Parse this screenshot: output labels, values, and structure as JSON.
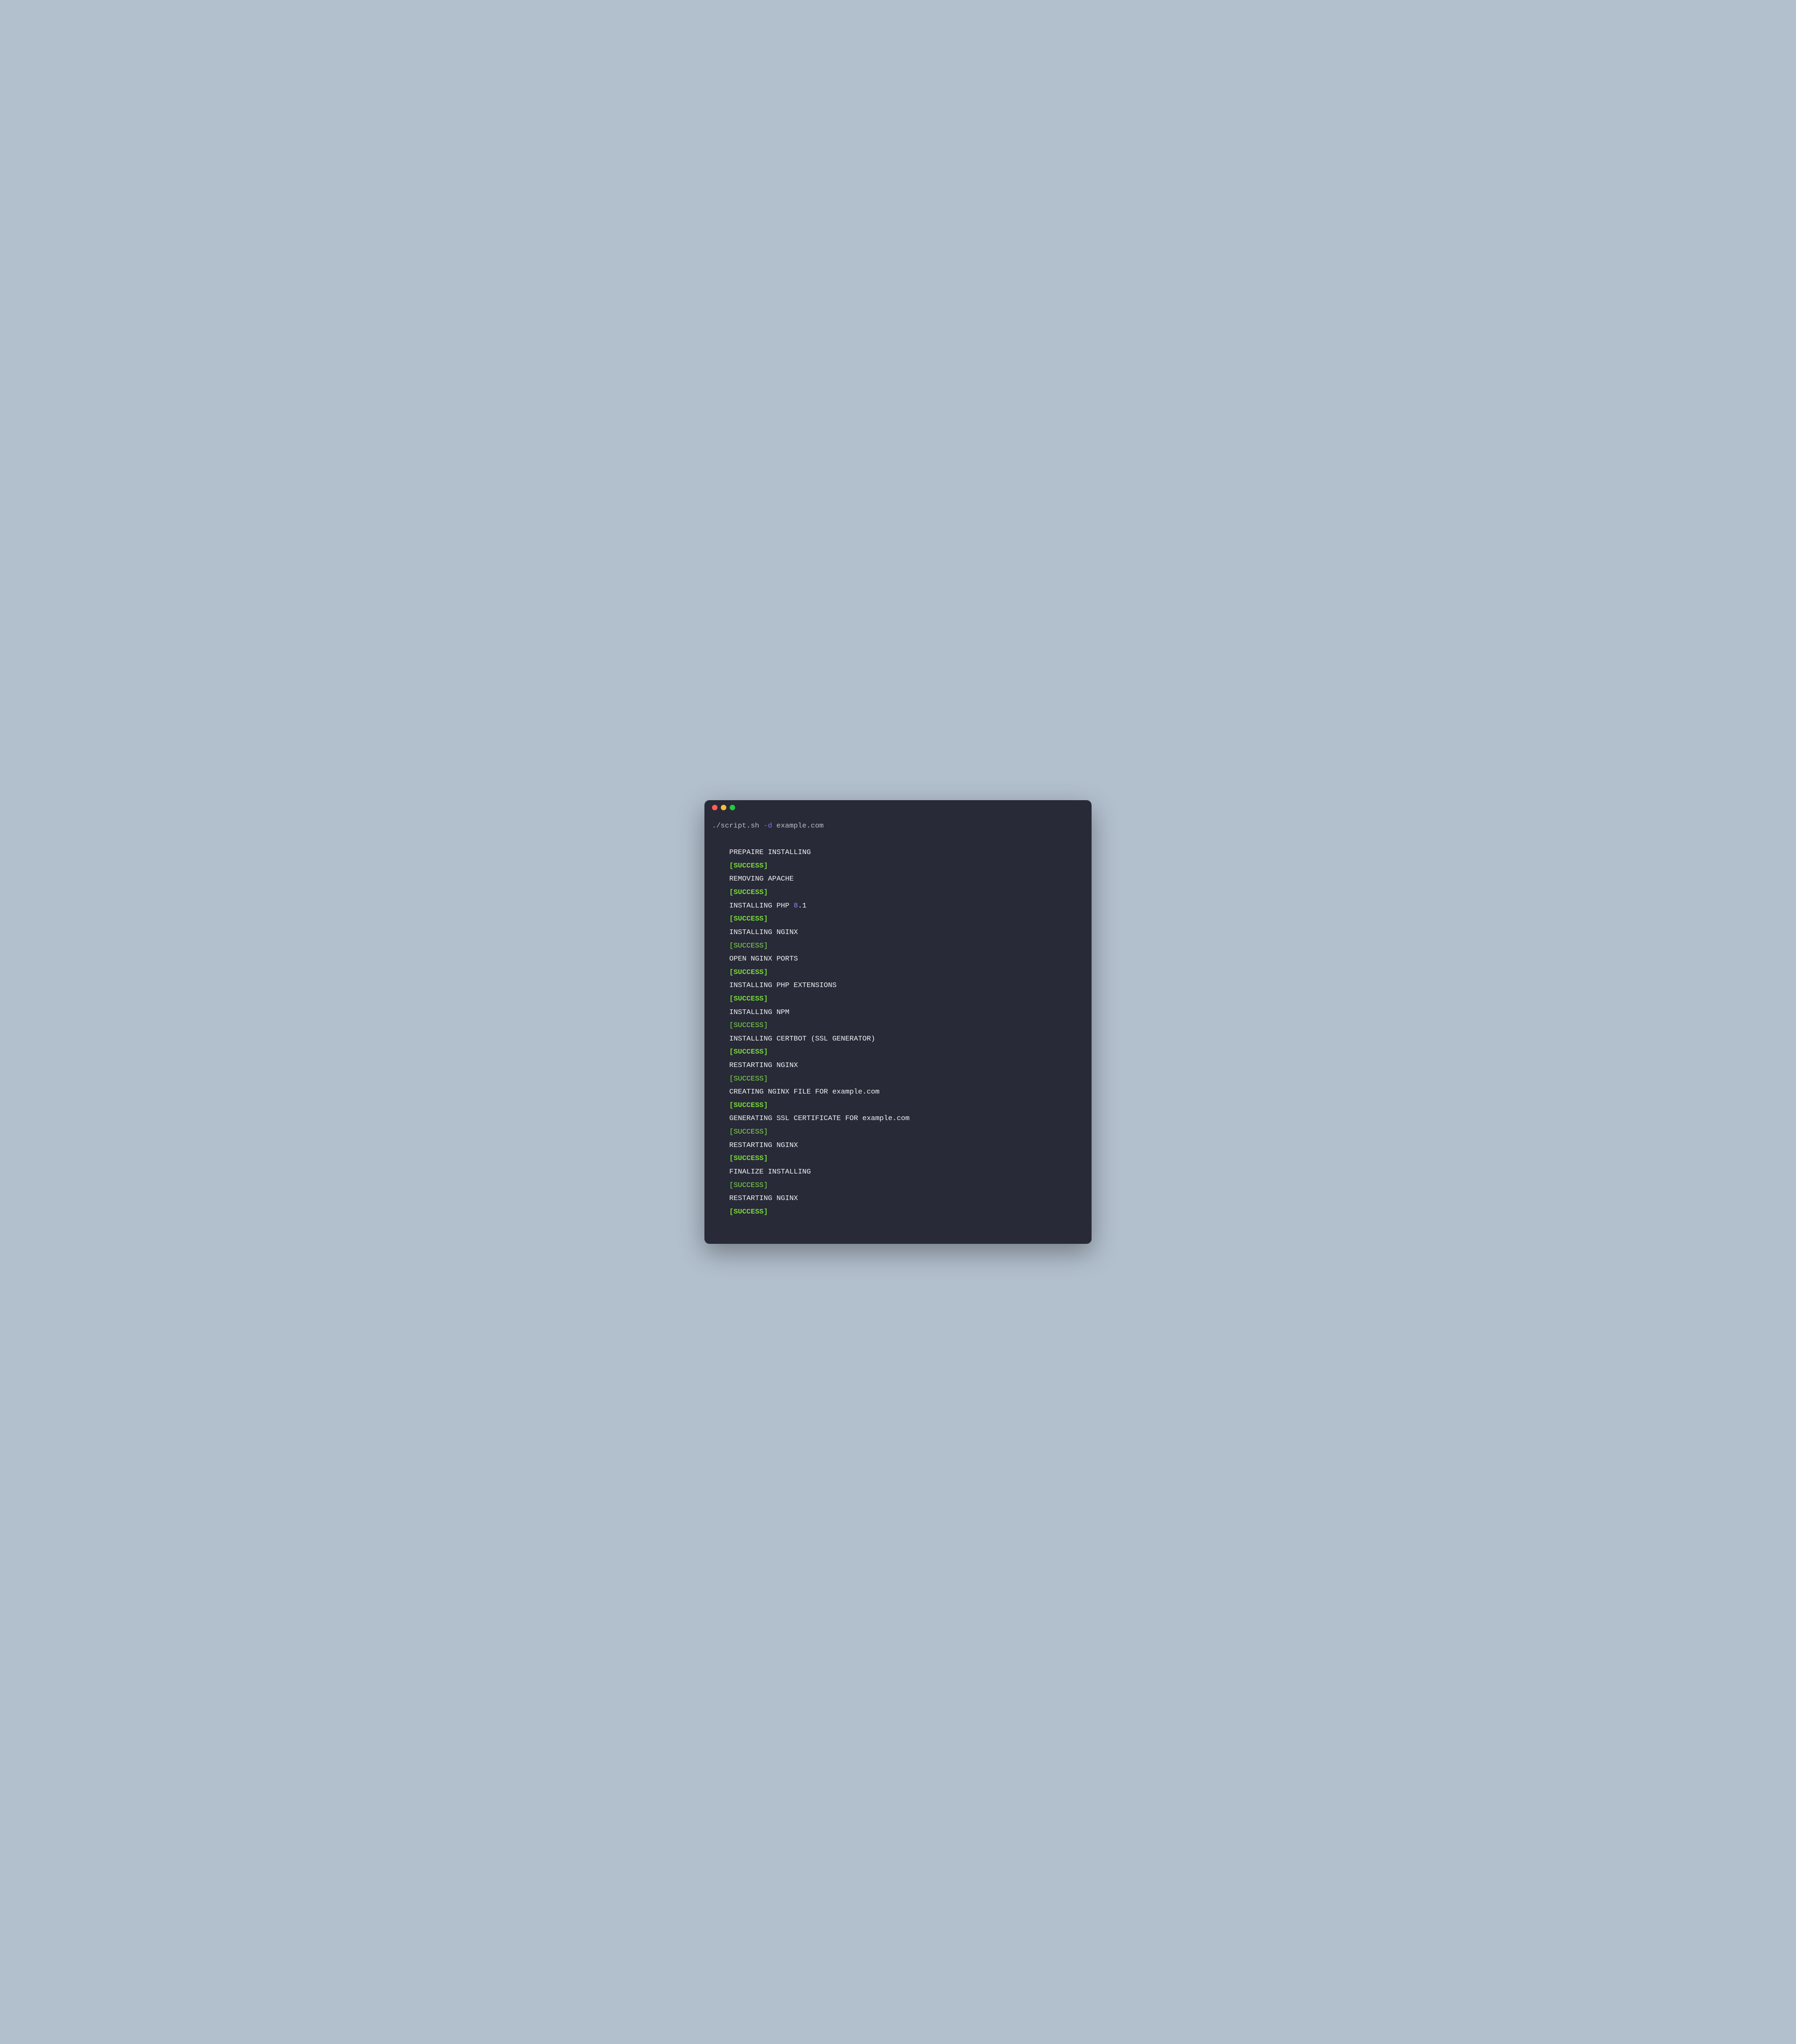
{
  "prompt": {
    "cmd": "./script.sh",
    "flag": "-d",
    "arg": "example.com"
  },
  "success_label": "[SUCCESS]",
  "steps": [
    {
      "text": "PREPAIRE INSTALLING",
      "success_style": "bold"
    },
    {
      "text": "REMOVING APACHE",
      "success_style": "bold"
    },
    {
      "prefix": "INSTALLING PHP ",
      "num": "8",
      "suffix": ".1",
      "success_style": "bold"
    },
    {
      "text": "INSTALLING NGINX",
      "success_style": "light"
    },
    {
      "text": "OPEN NGINX PORTS",
      "success_style": "bold"
    },
    {
      "text": "INSTALLING PHP EXTENSIONS",
      "success_style": "bold"
    },
    {
      "text": "INSTALLING NPM",
      "success_style": "light"
    },
    {
      "text": "INSTALLING CERTBOT (SSL GENERATOR)",
      "success_style": "bold"
    },
    {
      "text": "RESTARTING NGINX",
      "success_style": "light"
    },
    {
      "text": "CREATING NGINX FILE FOR example.com",
      "success_style": "bold"
    },
    {
      "text": "GENERATING SSL CERTIFICATE FOR example.com",
      "success_style": "light"
    },
    {
      "text": "RESTARTING NGINX",
      "success_style": "bold"
    },
    {
      "text": "FINALIZE INSTALLING",
      "success_style": "light"
    },
    {
      "text": "RESTARTING NGINX",
      "success_style": "bold"
    }
  ]
}
